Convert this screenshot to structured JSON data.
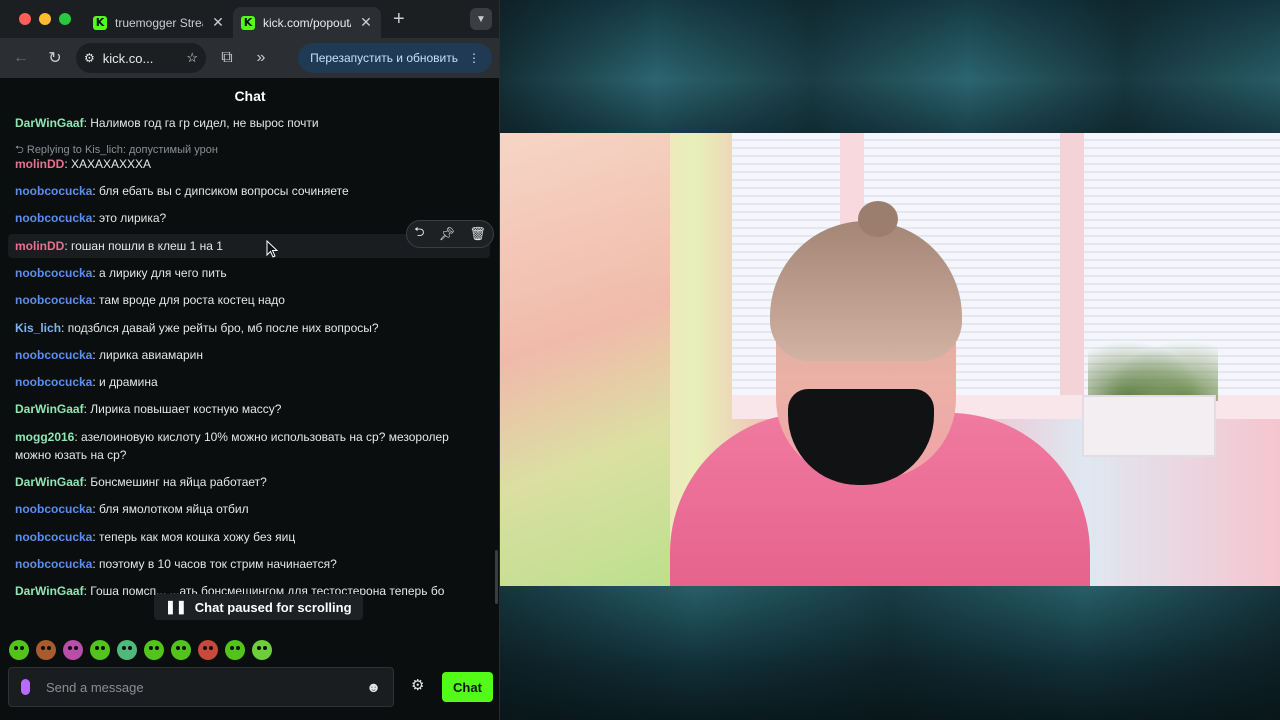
{
  "browser": {
    "tabs": [
      {
        "title": "truemogger Strea",
        "favicon": "K",
        "active": false
      },
      {
        "title": "kick.com/popout/",
        "favicon": "K",
        "active": true
      }
    ],
    "new_tab_icon": "+",
    "tab_menu_icon": "chevron-down-icon",
    "url": "kick.co...",
    "update_button": "Перезапустить и обновить",
    "traffic_colors": [
      "#ff5f57",
      "#febc2e",
      "#28c840"
    ]
  },
  "chat": {
    "title": "Chat",
    "reply_context": "Replying to Kis_lich: допустимый урон",
    "messages": [
      {
        "user": "DarWinGaaf",
        "color": "#8ee6b3",
        "text": "Налимов год га гр сидел, не вырос почти"
      },
      {
        "user": "molinDD",
        "color": "#e7718f",
        "text": "ХАХАХАХХХА"
      },
      {
        "user": "noobcocucka",
        "color": "#5b8ef0",
        "text": "бля ебать вы с дипсиком вопросы сочиняете"
      },
      {
        "user": "noobcocucka",
        "color": "#5b8ef0",
        "text": "это лирика?"
      },
      {
        "user": "molinDD",
        "color": "#e7718f",
        "text": "гошан пошли в клеш 1 на 1"
      },
      {
        "user": "noobcocucka",
        "color": "#5b8ef0",
        "text": "а лирику для чего пить"
      },
      {
        "user": "noobcocucka",
        "color": "#5b8ef0",
        "text": "там вроде для роста костец надо"
      },
      {
        "user": "Kis_lich",
        "color": "#7db4f0",
        "text": "подзблся давай уже рейты бро, мб после них вопросы?"
      },
      {
        "user": "noobcocucka",
        "color": "#5b8ef0",
        "text": "лирика авиамарин"
      },
      {
        "user": "noobcocucka",
        "color": "#5b8ef0",
        "text": "и драмина"
      },
      {
        "user": "DarWinGaaf",
        "color": "#8ee6b3",
        "text": "Лирика повышает костную массу?"
      },
      {
        "user": "mogg2016",
        "color": "#8ee6b3",
        "text": "азелоиновую кислоту 10% можно использовать на ср? мезоролер можно юзать на ср?"
      },
      {
        "user": "DarWinGaaf",
        "color": "#8ee6b3",
        "text": "Бонсмешинг на яйца работает?"
      },
      {
        "user": "noobcocucka",
        "color": "#5b8ef0",
        "text": "бля ямолотком яйца отбил"
      },
      {
        "user": "noobcocucka",
        "color": "#5b8ef0",
        "text": "теперь как моя кошка хожу без яиц"
      },
      {
        "user": "noobcocucka",
        "color": "#5b8ef0",
        "text": "поэтому в 10 часов ток стрим начинается?"
      },
      {
        "user": "DarWinGaaf",
        "color": "#8ee6b3",
        "text": "Гоша помсп... ...ать бонсмешингом для тестостерона теперь бо"
      }
    ],
    "paused_label": "Chat paused for scrolling",
    "input_placeholder": "Send a message",
    "send_label": "Chat",
    "accent": "#53fc18"
  }
}
